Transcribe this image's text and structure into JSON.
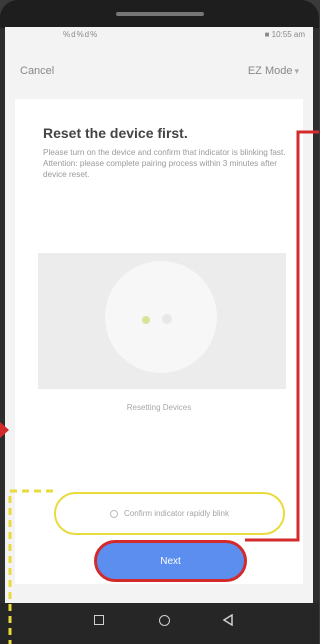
{
  "status_bar": {
    "left": "%d%d%",
    "right": "■ 10:55 am"
  },
  "nav": {
    "cancel": "Cancel",
    "mode": "EZ Mode",
    "mode_chevron": "▾"
  },
  "content": {
    "title": "Reset the device first.",
    "description": "Please turn on the device and confirm that indicator is blinking fast.",
    "attention": "Attention: please complete pairing process within 3 minutes after device reset.",
    "caption": "Resetting Devices"
  },
  "confirm": {
    "label": "Confirm indicator rapidly blink"
  },
  "next_button": {
    "label": "Next"
  },
  "annotation_colors": {
    "red": "#d32b2b",
    "yellow": "#eadb3c",
    "accent": "#5c8ef0"
  },
  "icons": [
    "back-icon",
    "home-icon",
    "recent-apps-icon"
  ]
}
